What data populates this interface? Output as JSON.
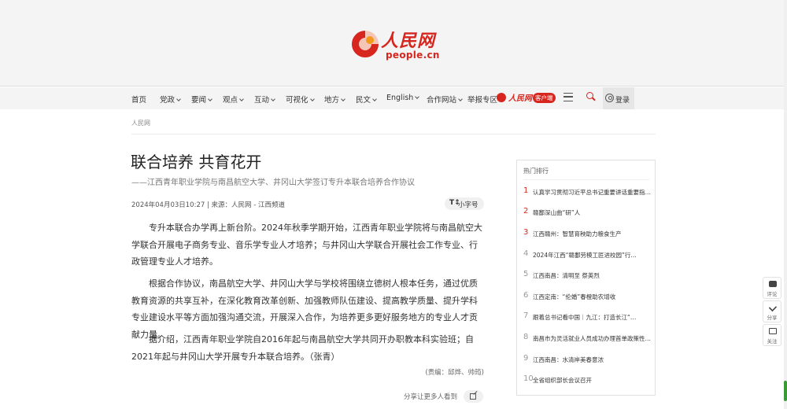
{
  "brand": {
    "logo_cn": "人民网",
    "logo_en": "people.cn"
  },
  "nav": {
    "items": [
      {
        "label": "首页",
        "dropdown": false
      },
      {
        "label": "党政",
        "dropdown": true
      },
      {
        "label": "要闻",
        "dropdown": true
      },
      {
        "label": "观点",
        "dropdown": true
      },
      {
        "label": "互动",
        "dropdown": true
      },
      {
        "label": "可视化",
        "dropdown": true
      },
      {
        "label": "地方",
        "dropdown": true
      },
      {
        "label": "民文",
        "dropdown": true
      },
      {
        "label": "English",
        "dropdown": true
      },
      {
        "label": "合作网站",
        "dropdown": true
      },
      {
        "label": "举报专区",
        "dropdown": false
      }
    ],
    "app_name": "人民网+",
    "app_badge": "客户端",
    "login_label": "登录"
  },
  "breadcrumb": "人民网",
  "article": {
    "title": "联合培养 共育花开",
    "subtitle": "——江西青年职业学院与南昌航空大学、井冈山大学签订专升本联合培养合作协议",
    "meta": "2024年04月03日10:27 | 来源：人民网 - 江西频道",
    "font_toggle": "小字号",
    "font_toggle_icon": "T↕",
    "paragraphs": [
      "专升本联合办学再上新台阶。2024年秋季学期开始，江西青年职业学院将与南昌航空大学联合开展电子商务专业、音乐学专业人才培养；与井冈山大学联合开展社会工作专业、行政管理专业人才培养。",
      "根据合作协议，南昌航空大学、井冈山大学与学校将围绕立德树人根本任务，通过优质教育资源的共享互补，在深化教育改革创新、加强教师队伍建设、提高教学质量、提升学科专业建设水平等方面加强沟通交流，开展深入合作，为培养更多更好服务地方的专业人才贡献力量。",
      "据介绍，江西青年职业学院自2016年起与南昌航空大学共同开办职教本科实验班；自2021年起与井冈山大学开展专升本联合培养。（张青）"
    ],
    "editor": "(责编：邱烨、帅筠)",
    "share_label": "分享让更多人看到"
  },
  "hot": {
    "title": "热门排行",
    "items": [
      {
        "rank": "1",
        "text": "认真学习贯彻习近平总书记重要讲话重要指…"
      },
      {
        "rank": "2",
        "text": "赣鄱深山曲“研”人"
      },
      {
        "rank": "3",
        "text": "江西赣州：智慧育秧助力粮食生产"
      },
      {
        "rank": "4",
        "text": "2024年江西“赣鄱劳模工匠进校园”行…"
      },
      {
        "rank": "5",
        "text": "江西南昌：清明至 祭英烈"
      },
      {
        "rank": "6",
        "text": "江西定南：“伦婚”春橙助农增收"
      },
      {
        "rank": "7",
        "text": "跟着总书记看中国｜九江：打造长江“…"
      },
      {
        "rank": "8",
        "text": "南昌市为灵活就业人员成功办理首单政策性…"
      },
      {
        "rank": "9",
        "text": "江西南昌：水清岸美春意浓"
      },
      {
        "rank": "10",
        "text": "全省组织部长会议召开"
      }
    ]
  },
  "side_tools": {
    "comment": "评论",
    "share": "分享",
    "follow": "关注"
  },
  "colors": {
    "brand_red": "#d6261e"
  }
}
